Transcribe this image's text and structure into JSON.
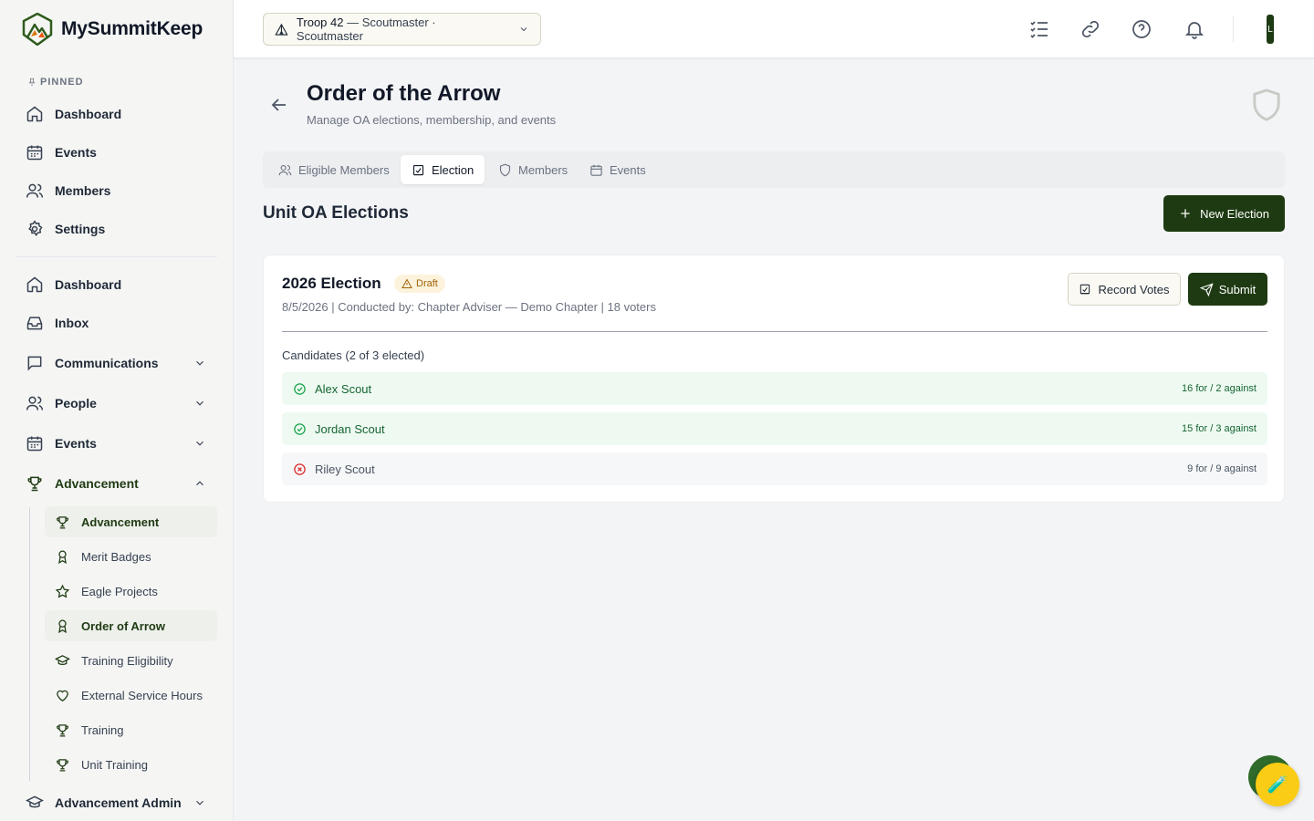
{
  "app": {
    "name": "MySummitKeep"
  },
  "sidebar": {
    "pinned_label": "PINNED",
    "pinned": [
      {
        "label": "Dashboard",
        "icon": "home-icon"
      },
      {
        "label": "Events",
        "icon": "calendar-icon"
      },
      {
        "label": "Members",
        "icon": "users-icon"
      },
      {
        "label": "Settings",
        "icon": "gear-icon"
      }
    ],
    "nav": [
      {
        "label": "Dashboard",
        "icon": "home-icon"
      },
      {
        "label": "Inbox",
        "icon": "inbox-icon"
      },
      {
        "label": "Communications",
        "icon": "chat-icon",
        "expandable": true
      },
      {
        "label": "People",
        "icon": "users-icon",
        "expandable": true
      },
      {
        "label": "Events",
        "icon": "calendar-icon",
        "expandable": true
      },
      {
        "label": "Advancement",
        "icon": "trophy-icon",
        "expandable": true,
        "expanded": true
      }
    ],
    "advancement_sub": [
      {
        "label": "Advancement",
        "icon": "trophy-icon",
        "active": true
      },
      {
        "label": "Merit Badges",
        "icon": "award-icon"
      },
      {
        "label": "Eagle Projects",
        "icon": "star-icon"
      },
      {
        "label": "Order of Arrow",
        "icon": "award-icon",
        "active": true
      },
      {
        "label": "Training Eligibility",
        "icon": "graduation-cap-icon"
      },
      {
        "label": "External Service Hours",
        "icon": "heart-icon"
      },
      {
        "label": "Training",
        "icon": "trophy-icon"
      },
      {
        "label": "Unit Training",
        "icon": "trophy-icon"
      }
    ],
    "advancement_admin": {
      "label": "Advancement Admin",
      "icon": "graduation-cap-icon"
    }
  },
  "topbar": {
    "troop_name": "Troop 42",
    "troop_role": " — Scoutmaster · Scoutmaster",
    "avatar_initial": "L"
  },
  "page": {
    "title": "Order of the Arrow",
    "subtitle": "Manage OA elections, membership, and events",
    "tabs": [
      {
        "label": "Eligible Members",
        "icon": "users-icon"
      },
      {
        "label": "Election",
        "icon": "ballot-icon",
        "active": true
      },
      {
        "label": "Members",
        "icon": "shield-icon"
      },
      {
        "label": "Events",
        "icon": "calendar-icon"
      }
    ],
    "section_title": "Unit OA Elections",
    "new_election_label": "New Election"
  },
  "election": {
    "title": "2026 Election",
    "status": "Draft",
    "meta": "8/5/2026 | Conducted by: Chapter Adviser — Demo Chapter | 18 voters",
    "record_votes_label": "Record Votes",
    "submit_label": "Submit",
    "candidates_heading": "Candidates (2 of 3 elected)",
    "candidates": [
      {
        "name": "Alex Scout",
        "votes": "16 for / 2 against",
        "elected": true
      },
      {
        "name": "Jordan Scout",
        "votes": "15 for / 3 against",
        "elected": true
      },
      {
        "name": "Riley Scout",
        "votes": "9 for / 9 against",
        "elected": false
      }
    ]
  },
  "colors": {
    "brand": "#1e3a12",
    "elected_bg": "#eefaf1",
    "draft_bg": "#fdf3dc",
    "fab": "#facc15"
  },
  "fab": {
    "glyph": "🧪"
  }
}
